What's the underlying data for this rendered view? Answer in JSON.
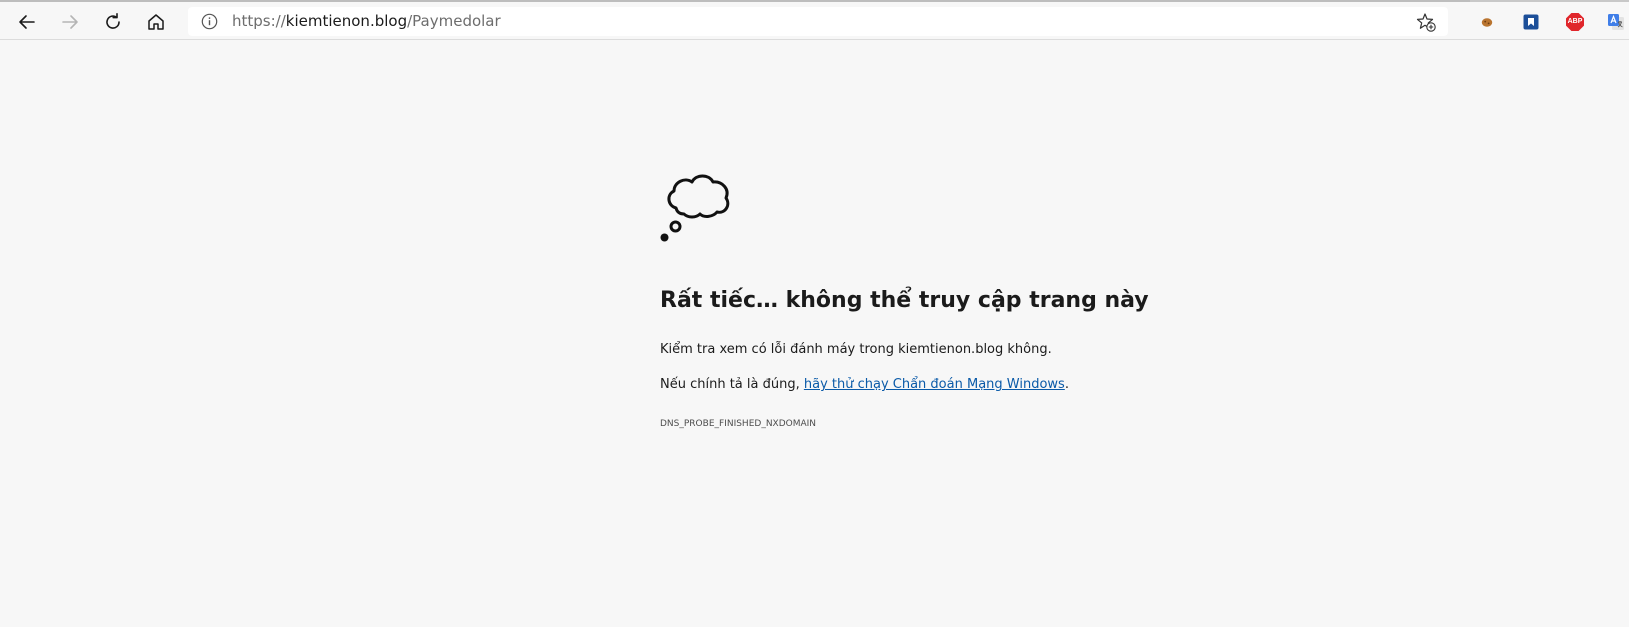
{
  "browser": {
    "url_scheme": "https://",
    "url_host": "kiemtienon.blog",
    "url_path": "/Paymedolar",
    "nav_icons": [
      "back-icon",
      "forward-icon",
      "refresh-icon",
      "home-icon"
    ],
    "address_icons": [
      "info-icon",
      "add-favorite-icon"
    ],
    "extensions": [
      {
        "name": "cookie-extension-icon"
      },
      {
        "name": "bookmark-extension-icon"
      },
      {
        "name": "adblock-plus-icon",
        "label": "ABP"
      },
      {
        "name": "google-translate-icon"
      }
    ],
    "colors": {
      "toolbar_bg": "#f7f7f7",
      "address_bg": "#ffffff",
      "link": "#0a5aa8"
    }
  },
  "error_page": {
    "icon": "thought-cloud-icon",
    "title": "Rất tiếc… không thể truy cập trang này",
    "check_text": "Kiểm tra xem có lỗi đánh máy trong kiemtienon.blog không.",
    "suggestion_prefix": "Nếu chính tả là đúng, ",
    "suggestion_link": "hãy thử chạy Chẩn đoán Mạng Windows",
    "suggestion_suffix": ".",
    "error_code": "DNS_PROBE_FINISHED_NXDOMAIN"
  }
}
